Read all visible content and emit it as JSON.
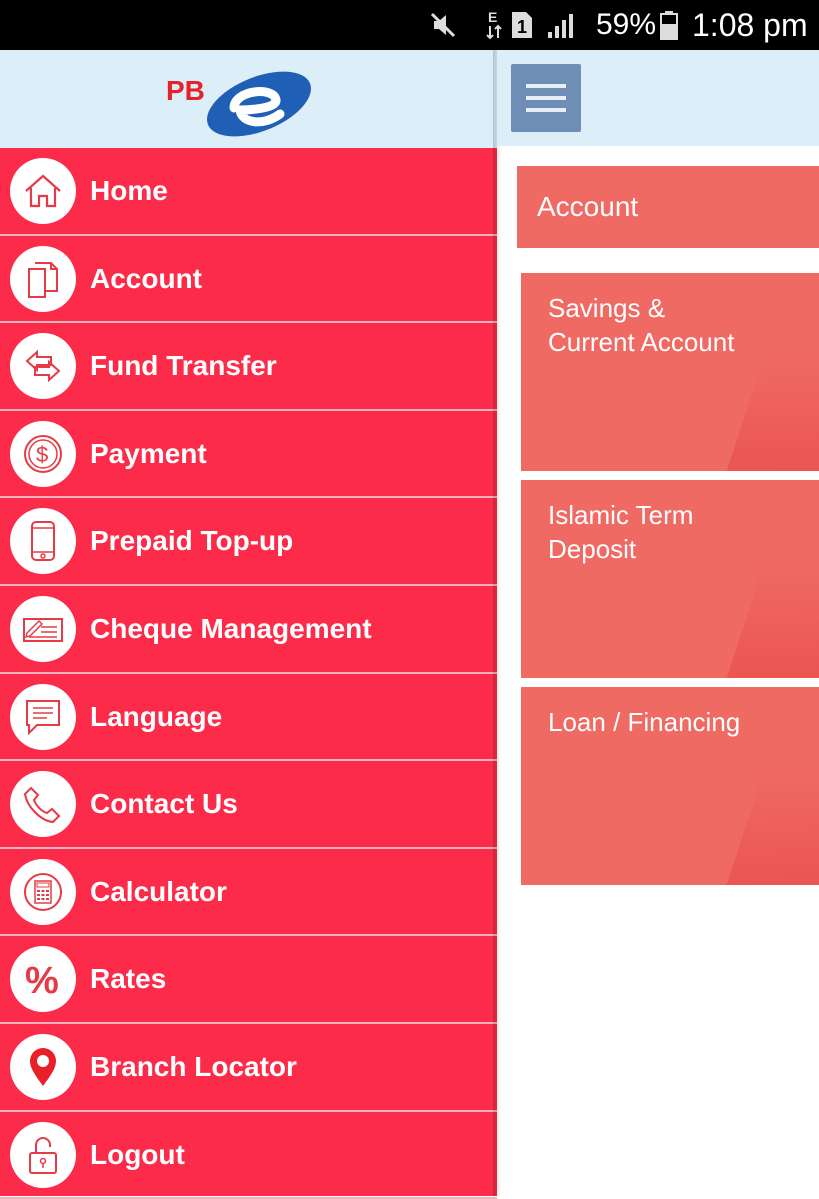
{
  "status_bar": {
    "battery": "59%",
    "time": "1:08 pm",
    "data_label": "E",
    "sim_label": "1",
    "icons": [
      "mute-icon",
      "data-e-icon",
      "sim-1-icon",
      "signal-icon",
      "battery-icon"
    ]
  },
  "drawer": {
    "logo": "PBe",
    "menu": [
      {
        "label": "Home",
        "icon": "home-icon"
      },
      {
        "label": "Account",
        "icon": "documents-icon"
      },
      {
        "label": "Fund Transfer",
        "icon": "transfer-arrows-icon"
      },
      {
        "label": "Payment",
        "icon": "dollar-coin-icon"
      },
      {
        "label": "Prepaid Top-up",
        "icon": "mobile-phone-icon"
      },
      {
        "label": "Cheque Management",
        "icon": "cheque-icon"
      },
      {
        "label": "Language",
        "icon": "speech-bubble-icon"
      },
      {
        "label": "Contact Us",
        "icon": "phone-icon"
      },
      {
        "label": "Calculator",
        "icon": "calculator-icon"
      },
      {
        "label": "Rates",
        "icon": "percent-icon"
      },
      {
        "label": "Branch Locator",
        "icon": "location-pin-icon"
      },
      {
        "label": "Logout",
        "icon": "unlock-icon"
      }
    ]
  },
  "main": {
    "menu_button_icon": "hamburger-menu-icon",
    "section_title": "Account",
    "cards": [
      {
        "label": "Savings &\nCurrent Account"
      },
      {
        "label": "Islamic Term\nDeposit"
      },
      {
        "label": "Loan / Financing"
      }
    ]
  },
  "colors": {
    "drawer_bg": "#fc2b49",
    "header_bg": "#dceef8",
    "card_bg": "#f06a64",
    "hamburger_bg": "#6e8eb5",
    "logo_red": "#e8202a",
    "logo_blue": "#1f5fb5"
  }
}
